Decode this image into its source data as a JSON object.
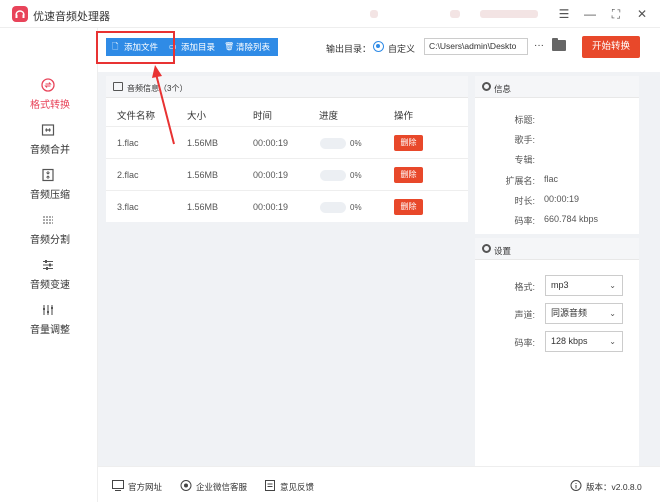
{
  "app": {
    "title": "优速音频处理器"
  },
  "window_controls": [
    "menu-icon",
    "minimize-icon",
    "fullscreen-icon",
    "close-icon"
  ],
  "sidebar": {
    "items": [
      {
        "label": "格式转换",
        "icon": "format-convert-icon",
        "active": true
      },
      {
        "label": "音频合并",
        "icon": "merge-icon",
        "active": false
      },
      {
        "label": "音频压缩",
        "icon": "compress-icon",
        "active": false
      },
      {
        "label": "音频分割",
        "icon": "split-icon",
        "active": false
      },
      {
        "label": "音频变速",
        "icon": "speed-icon",
        "active": false
      },
      {
        "label": "音量调整",
        "icon": "volume-icon",
        "active": false
      }
    ]
  },
  "toolbar": {
    "add_file": "添加文件",
    "add_dir": "添加目录",
    "clear_list": "清除列表",
    "output_label": "输出目录：",
    "custom_label": "自定义",
    "output_path": "C:\\Users\\admin\\Deskto",
    "more": "···",
    "start": "开始转换"
  },
  "file_panel": {
    "title": "音频信息（3个）",
    "columns": [
      "文件名称",
      "大小",
      "时间",
      "进度",
      "操作"
    ],
    "rows": [
      {
        "name": "1.flac",
        "size": "1.56MB",
        "time": "00:00:19",
        "progress": "0%",
        "action": "删除"
      },
      {
        "name": "2.flac",
        "size": "1.56MB",
        "time": "00:00:19",
        "progress": "0%",
        "action": "删除"
      },
      {
        "name": "3.flac",
        "size": "1.56MB",
        "time": "00:00:19",
        "progress": "0%",
        "action": "删除"
      }
    ]
  },
  "info_panel": {
    "title": "信息",
    "fields": [
      {
        "label": "标题:",
        "value": ""
      },
      {
        "label": "歌手:",
        "value": ""
      },
      {
        "label": "专辑:",
        "value": ""
      },
      {
        "label": "扩展名:",
        "value": "flac"
      },
      {
        "label": "时长:",
        "value": "00:00:19"
      },
      {
        "label": "码率:",
        "value": "660.784 kbps"
      }
    ]
  },
  "settings_panel": {
    "title": "设置",
    "fields": [
      {
        "label": "格式:",
        "value": "mp3"
      },
      {
        "label": "声道:",
        "value": "同源音频"
      },
      {
        "label": "码率:",
        "value": "128 kbps"
      }
    ]
  },
  "footer": {
    "website": "官方网址",
    "wechat": "企业微信客服",
    "feedback": "意见反馈",
    "version": "版本：v2.0.8.0"
  },
  "colors": {
    "accent": "#2f8be6",
    "brand": "#e8445a",
    "danger": "#e8482a",
    "highlight": "#e83232"
  }
}
